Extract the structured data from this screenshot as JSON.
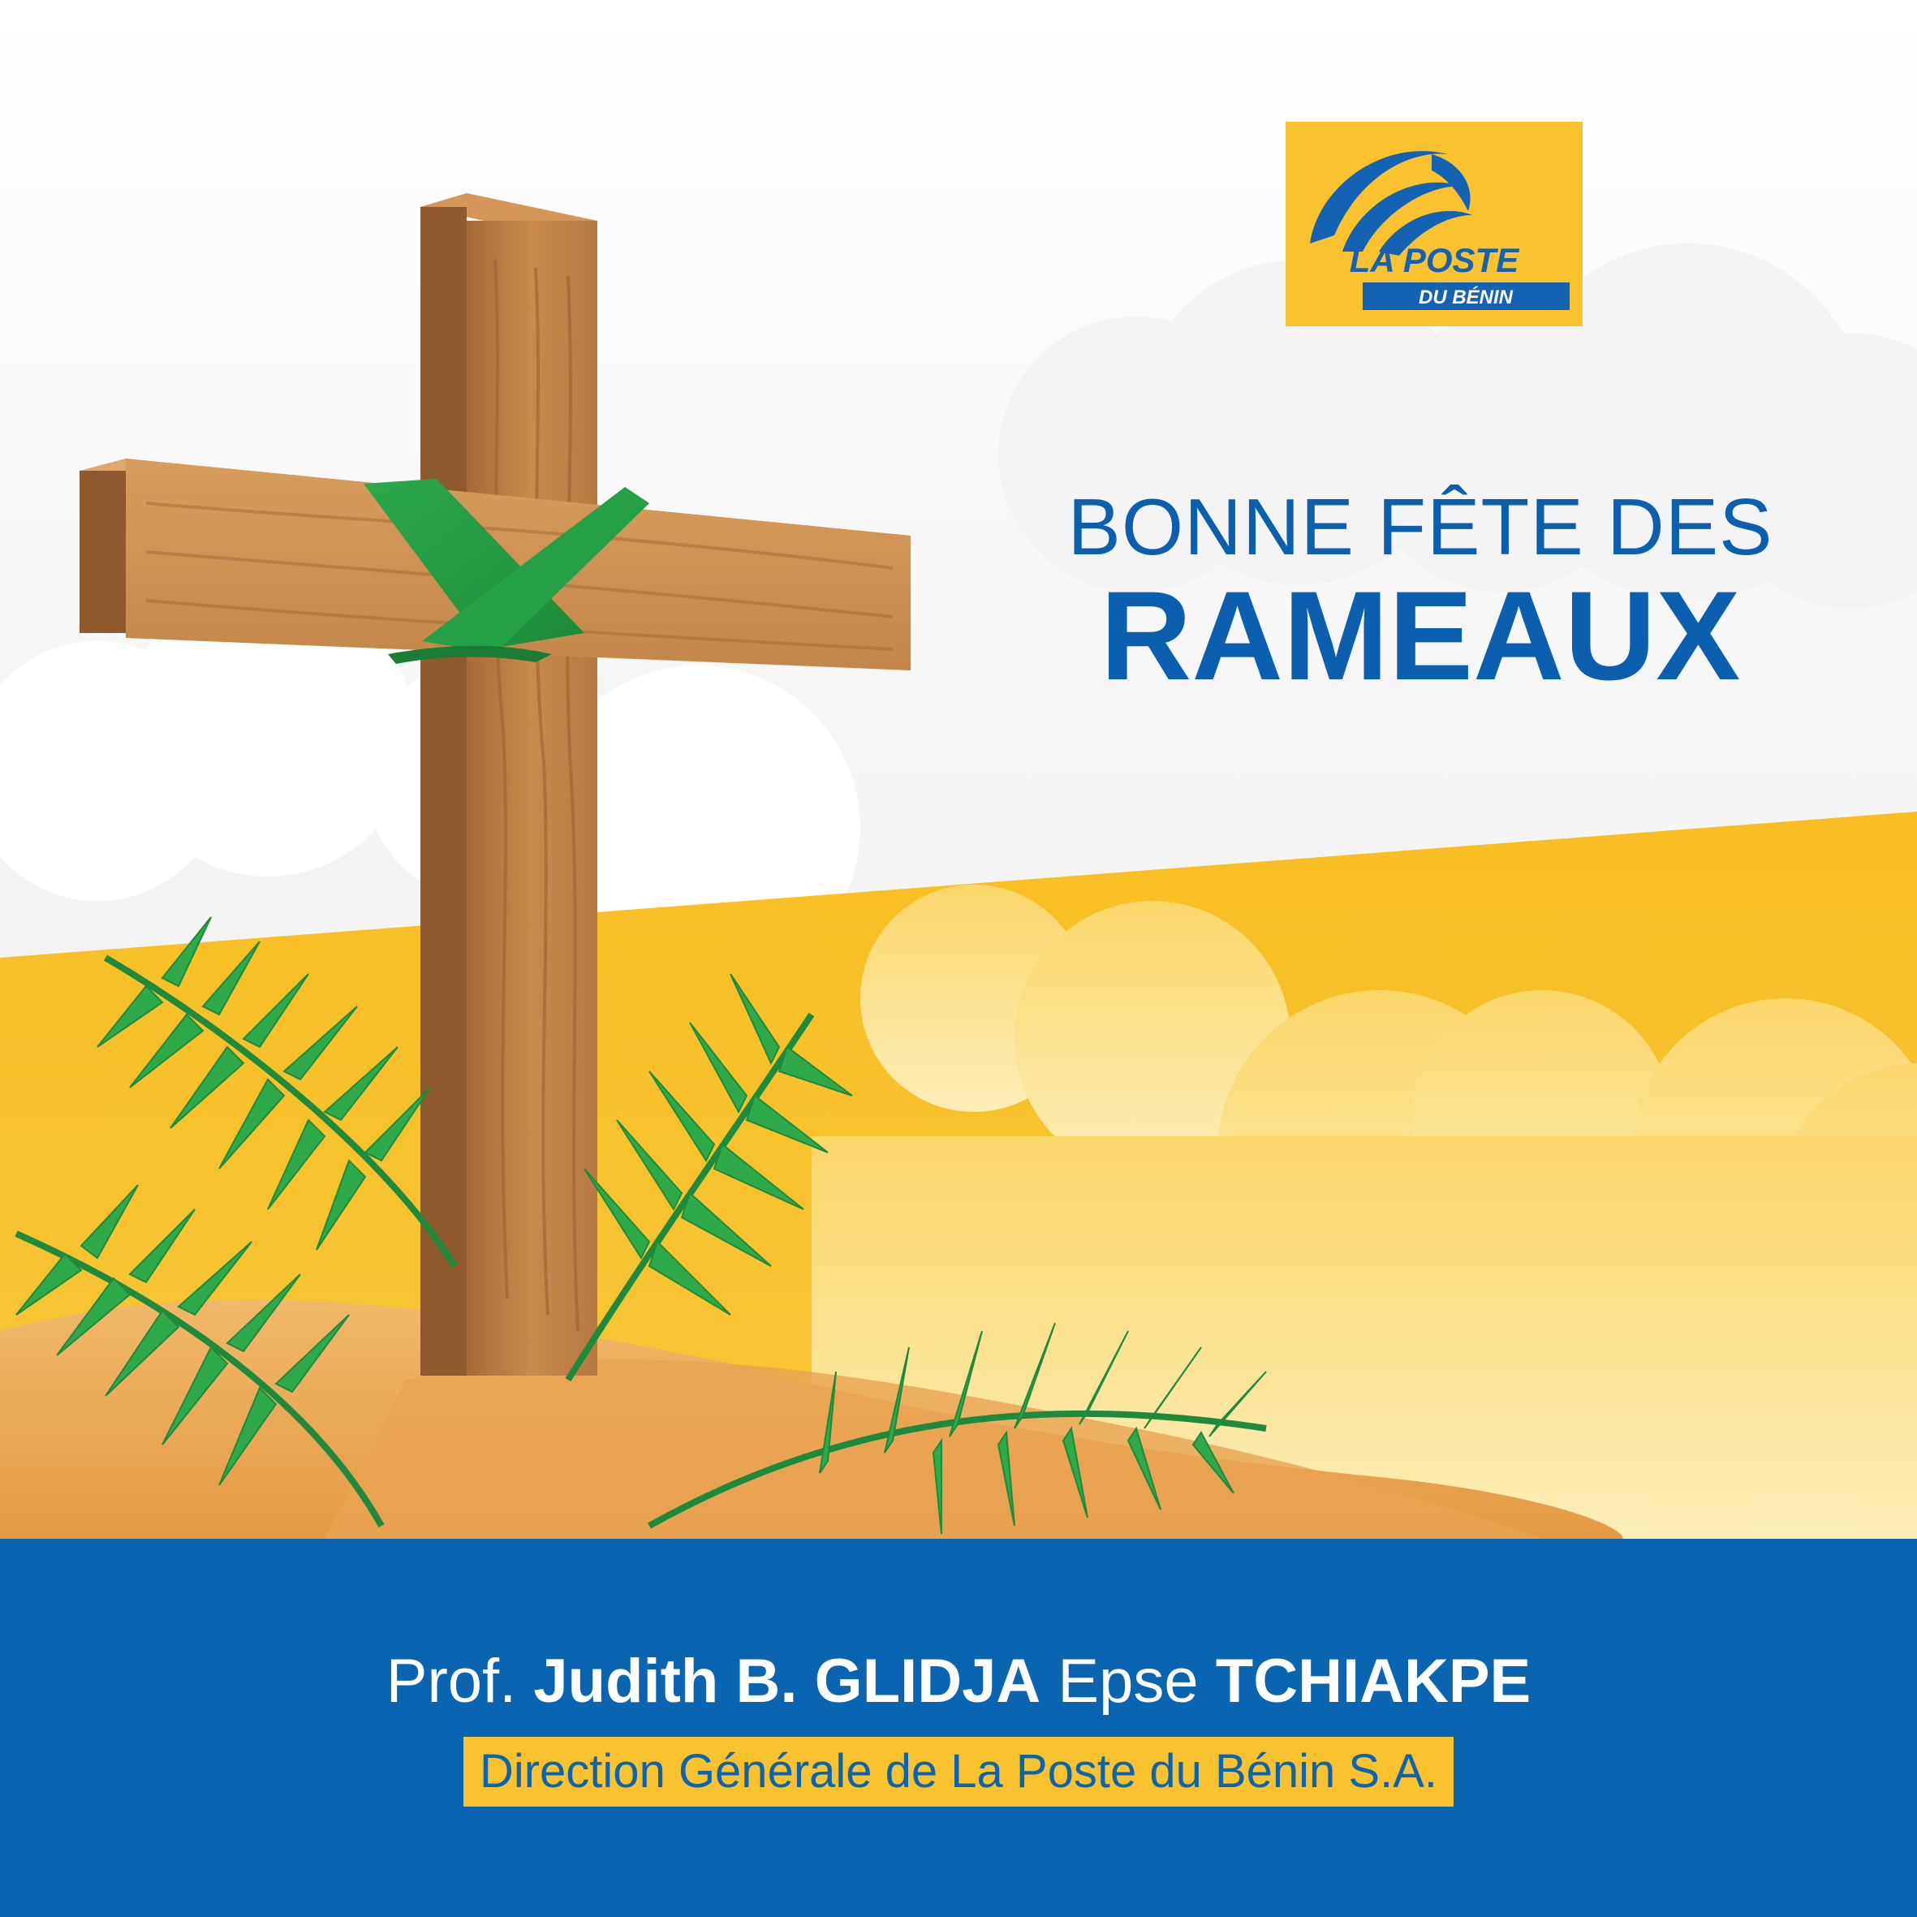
{
  "brand": {
    "line1": "LA POSTE",
    "line2": "DU BÉNIN",
    "colors": {
      "yellow": "#F9C22E",
      "blue": "#0A64AF"
    }
  },
  "greeting": {
    "line1": "BONNE FÊTE DES",
    "line2": "RAMEAUX"
  },
  "signer": {
    "title": "Prof.",
    "name": "Judith B. GLIDJA",
    "connector": "Epse",
    "surname": "TCHIAKPE"
  },
  "organization": "Direction Générale de La Poste du Bénin S.A.",
  "illustration": {
    "elements": [
      "wooden-cross",
      "palm-leaf-ribbon",
      "palm-fronds",
      "clouds",
      "sand-dunes"
    ]
  }
}
